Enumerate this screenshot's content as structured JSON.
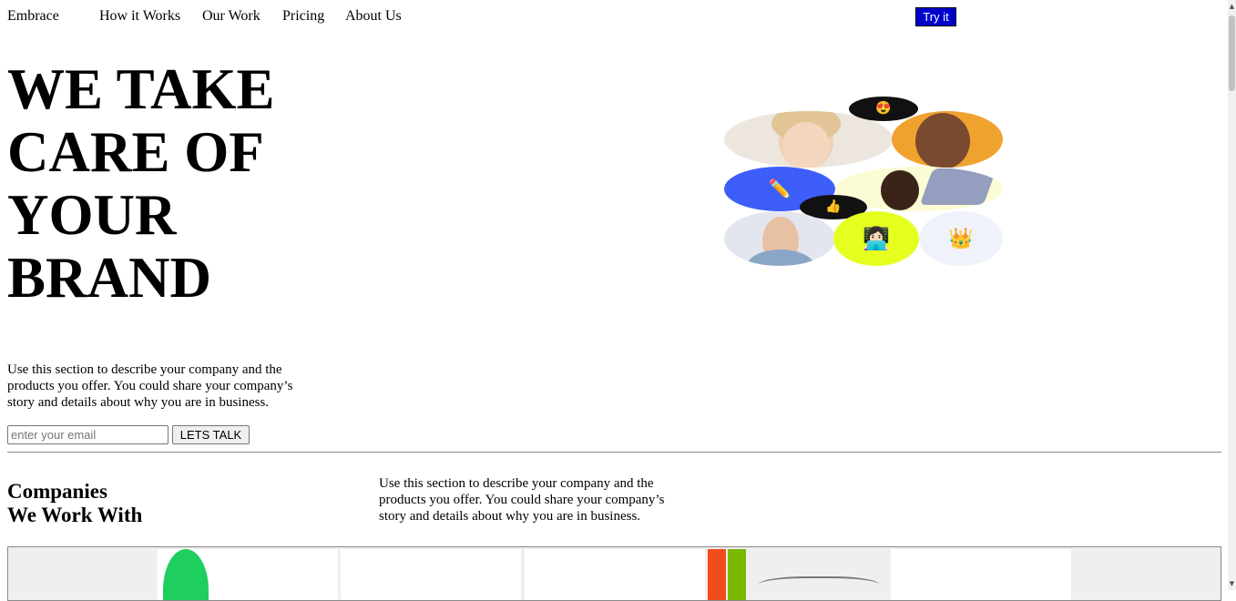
{
  "nav": {
    "brand": "Embrace",
    "links": [
      "How it Works",
      "Our Work",
      "Pricing",
      "About Us"
    ],
    "try_label": "Try it"
  },
  "hero": {
    "title": "WE TAKE CARE OF YOUR BRAND",
    "description": "Use this section to describe your company and the products you offer. You could share your company’s story and details about why you are in business.",
    "email_placeholder": "enter your email",
    "cta_label": "LETS TALK"
  },
  "collage": {
    "bubble_top_emoji": "😍",
    "bubble_mid_emoji": "👍",
    "pencil_emoji": "✏️",
    "laptop_emoji": "👩🏻‍💻",
    "crown_emoji": "👑"
  },
  "companies": {
    "title_line1": "Companies",
    "title_line2": "We Work With",
    "description": "Use this section to describe your company and the products you offer. You could share your company’s story and details about why you are in business."
  },
  "colors": {
    "try_button": "#0000cd",
    "pencil_blob": "#3d5efa",
    "laptop_blob": "#e5ff1f",
    "face_right_bg": "#f0a22e",
    "logo_green": "#1ece5e",
    "logo_orange": "#f04d1d",
    "logo_lime": "#7ab800"
  }
}
